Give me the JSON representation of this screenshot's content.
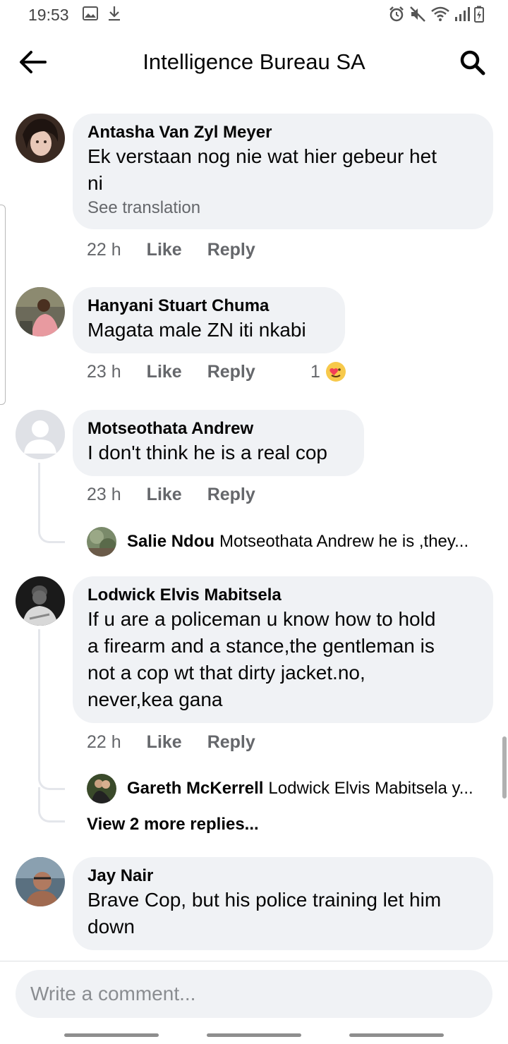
{
  "status_bar": {
    "time": "19:53",
    "left_icons": [
      "image-icon",
      "download-icon"
    ],
    "right_icons": [
      "alarm-icon",
      "mute-icon",
      "wifi-icon",
      "signal-icon",
      "battery-icon"
    ]
  },
  "header": {
    "title": "Intelligence Bureau SA",
    "back_icon": "arrow-left-icon",
    "search_icon": "search-icon"
  },
  "comments": [
    {
      "author": "Antasha Van Zyl Meyer",
      "text_lines": [
        "Ek verstaan nog nie wat hier gebeur het",
        "ni"
      ],
      "see_translation": "See translation",
      "time": "22 h",
      "like": "Like",
      "reply": "Reply"
    },
    {
      "author": "Hanyani Stuart Chuma",
      "text_lines": [
        "Magata male ZN iti nkabi"
      ],
      "time": "23 h",
      "like": "Like",
      "reply": "Reply",
      "reaction_count": "1",
      "reaction_icon": "care-reaction-icon"
    },
    {
      "author": "Motseothata Andrew",
      "text_lines": [
        "I don't think he is a real cop"
      ],
      "time": "23 h",
      "like": "Like",
      "reply": "Reply",
      "reply_preview": {
        "name": "Salie Ndou",
        "text": "Motseothata Andrew he is ,they..."
      }
    },
    {
      "author": "Lodwick Elvis Mabitsela",
      "text_lines": [
        "If u are a policeman u know how to hold",
        "a firearm and a stance,the gentleman is",
        "not a cop wt that dirty jacket.no,",
        "never,kea gana"
      ],
      "time": "22 h",
      "like": "Like",
      "reply": "Reply",
      "reply_preview": {
        "name": "Gareth McKerrell",
        "text": "Lodwick Elvis Mabitsela y..."
      },
      "more_replies": "View 2 more replies..."
    },
    {
      "author": "Jay Nair",
      "text_lines": [
        "Brave Cop, but his police training let him",
        "down"
      ]
    }
  ],
  "composer": {
    "placeholder": "Write a comment..."
  },
  "colors": {
    "bubble": "#f0f2f5",
    "secondary_text": "#65676b",
    "primary_text": "#050505"
  }
}
